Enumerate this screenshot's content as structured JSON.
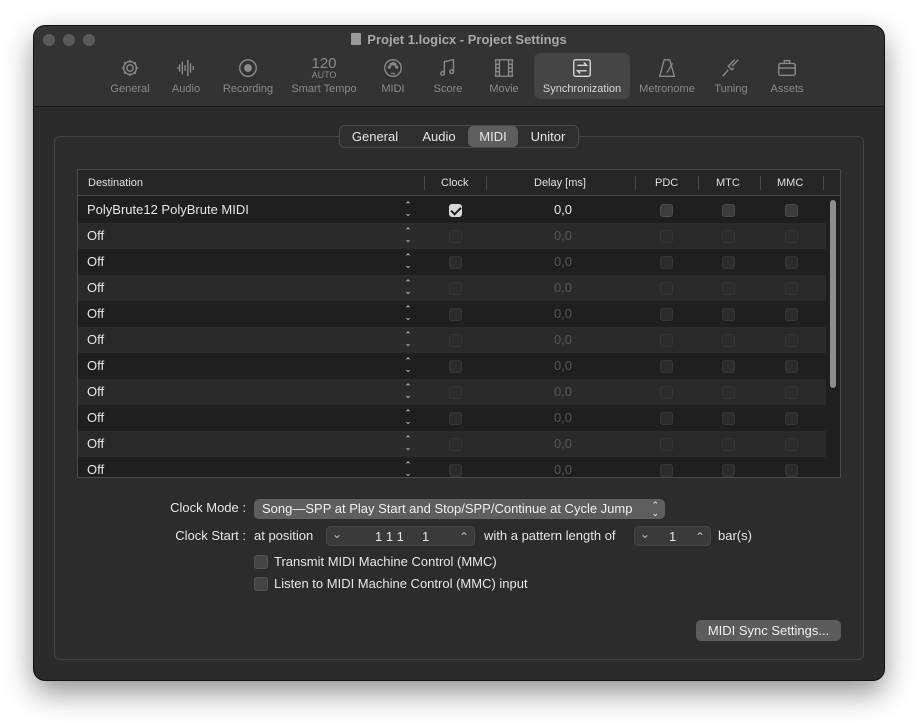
{
  "window": {
    "title": "Projet 1.logicx - Project Settings"
  },
  "toolbar": {
    "items": [
      {
        "label": "General",
        "icon": "gear-icon"
      },
      {
        "label": "Audio",
        "icon": "waveform-icon"
      },
      {
        "label": "Recording",
        "icon": "record-icon"
      },
      {
        "label": "Smart Tempo",
        "icon": "tempo-icon",
        "icon_text": "120",
        "icon_subtext": "AUTO"
      },
      {
        "label": "MIDI",
        "icon": "midi-icon"
      },
      {
        "label": "Score",
        "icon": "music-notes-icon"
      },
      {
        "label": "Movie",
        "icon": "film-icon"
      },
      {
        "label": "Synchronization",
        "icon": "sync-icon"
      },
      {
        "label": "Metronome",
        "icon": "metronome-icon"
      },
      {
        "label": "Tuning",
        "icon": "tuning-fork-icon"
      },
      {
        "label": "Assets",
        "icon": "briefcase-icon"
      }
    ],
    "active": "Synchronization"
  },
  "tabs": {
    "items": [
      "General",
      "Audio",
      "MIDI",
      "Unitor"
    ],
    "active": "MIDI"
  },
  "table": {
    "headers": {
      "destination": "Destination",
      "clock": "Clock",
      "delay": "Delay [ms]",
      "pdc": "PDC",
      "mtc": "MTC",
      "mmc": "MMC"
    },
    "rows": [
      {
        "destination": "PolyBrute12 PolyBrute MIDI",
        "clock": true,
        "delay": "0,0",
        "pdc": false,
        "mtc": false,
        "mmc": false,
        "enabled": true
      },
      {
        "destination": "Off",
        "clock": false,
        "delay": "0,0",
        "pdc": false,
        "mtc": false,
        "mmc": false,
        "enabled": false
      },
      {
        "destination": "Off",
        "clock": false,
        "delay": "0,0",
        "pdc": false,
        "mtc": false,
        "mmc": false,
        "enabled": false
      },
      {
        "destination": "Off",
        "clock": false,
        "delay": "0,0",
        "pdc": false,
        "mtc": false,
        "mmc": false,
        "enabled": false
      },
      {
        "destination": "Off",
        "clock": false,
        "delay": "0,0",
        "pdc": false,
        "mtc": false,
        "mmc": false,
        "enabled": false
      },
      {
        "destination": "Off",
        "clock": false,
        "delay": "0,0",
        "pdc": false,
        "mtc": false,
        "mmc": false,
        "enabled": false
      },
      {
        "destination": "Off",
        "clock": false,
        "delay": "0,0",
        "pdc": false,
        "mtc": false,
        "mmc": false,
        "enabled": false
      },
      {
        "destination": "Off",
        "clock": false,
        "delay": "0,0",
        "pdc": false,
        "mtc": false,
        "mmc": false,
        "enabled": false
      },
      {
        "destination": "Off",
        "clock": false,
        "delay": "0,0",
        "pdc": false,
        "mtc": false,
        "mmc": false,
        "enabled": false
      },
      {
        "destination": "Off",
        "clock": false,
        "delay": "0,0",
        "pdc": false,
        "mtc": false,
        "mmc": false,
        "enabled": false
      },
      {
        "destination": "Off",
        "clock": false,
        "delay": "0,0",
        "pdc": false,
        "mtc": false,
        "mmc": false,
        "enabled": false
      }
    ]
  },
  "clock_mode": {
    "label": "Clock Mode :",
    "value": "Song—SPP at Play Start and Stop/SPP/Continue at Cycle Jump"
  },
  "clock_start": {
    "label": "Clock Start :",
    "at_position_label": "at position",
    "position_value": "1 1 1     1",
    "pattern_label": "with a pattern length of",
    "pattern_value": "1",
    "unit_label": "bar(s)"
  },
  "options": {
    "transmit_mmc": {
      "label": "Transmit MIDI Machine Control (MMC)",
      "checked": false
    },
    "listen_mmc": {
      "label": "Listen to MIDI Machine Control (MMC) input",
      "checked": false
    }
  },
  "buttons": {
    "midi_sync_settings": "MIDI Sync Settings..."
  },
  "colors": {
    "window_bg": "#2b2b2b",
    "toolbar_bg": "#333333",
    "active_tab": "#5e5e5e",
    "row_alt": "#2a2a2a"
  }
}
